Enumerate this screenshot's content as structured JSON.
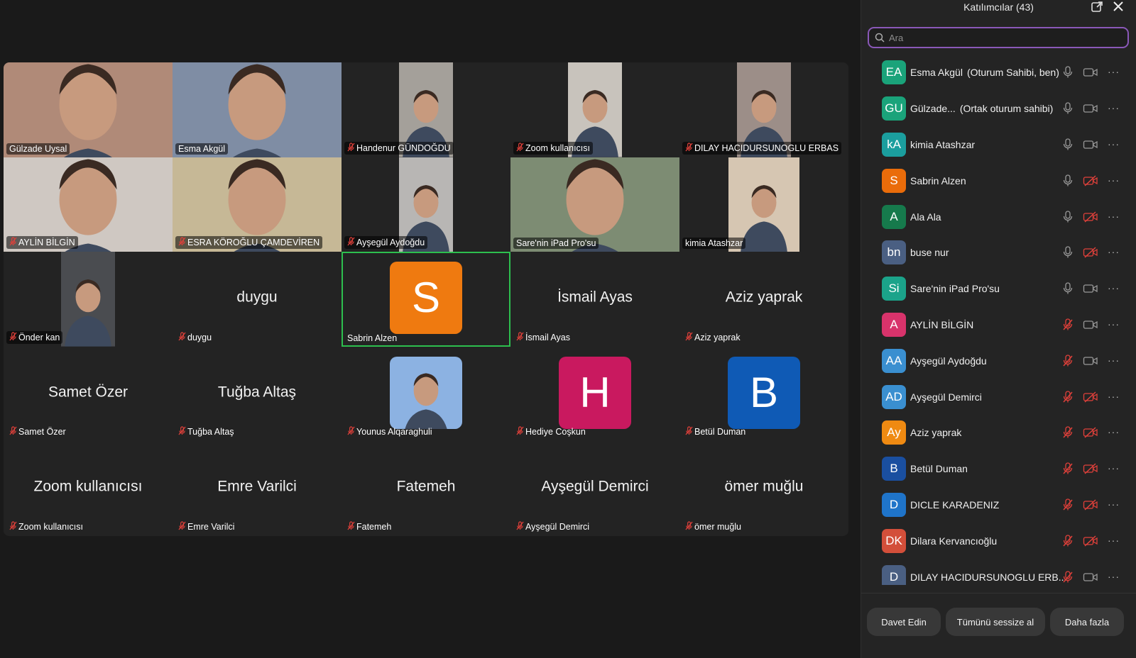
{
  "sidebar": {
    "title": "Katılımcılar (43)",
    "search_placeholder": "Ara",
    "participants": [
      {
        "initials": "EA",
        "name": "Esma Akgül",
        "role": "(Oturum Sahibi, ben)",
        "color": "#1aa37a",
        "mic": "on",
        "cam": "on"
      },
      {
        "initials": "GU",
        "name": "Gülzade...",
        "role": "(Ortak oturum sahibi)",
        "color": "#1aa37a",
        "mic": "on",
        "cam": "on"
      },
      {
        "initials": "kA",
        "name": "kimia Atashzar",
        "role": "",
        "color": "#1b9e9e",
        "mic": "on",
        "cam": "on"
      },
      {
        "initials": "S",
        "name": "Sabrin Alzen",
        "role": "",
        "color": "#ea6c0a",
        "mic": "on",
        "cam": "off"
      },
      {
        "initials": "A",
        "name": "Ala Ala",
        "role": "",
        "color": "#167a4c",
        "mic": "on",
        "cam": "off"
      },
      {
        "initials": "bn",
        "name": "buse nur",
        "role": "",
        "color": "#4a5f82",
        "mic": "on",
        "cam": "off"
      },
      {
        "initials": "Si",
        "name": "Sare'nin iPad Pro'su",
        "role": "",
        "color": "#1ba38a",
        "mic": "on",
        "cam": "on"
      },
      {
        "initials": "A",
        "name": "AYLİN BİLGİN",
        "role": "",
        "color": "#d8336b",
        "mic": "off",
        "cam": "on"
      },
      {
        "initials": "AA",
        "name": "Ayşegül Aydoğdu",
        "role": "",
        "color": "#3a8fd0",
        "mic": "off",
        "cam": "on"
      },
      {
        "initials": "AD",
        "name": "Ayşegül Demirci",
        "role": "",
        "color": "#3a8fd0",
        "mic": "off",
        "cam": "off"
      },
      {
        "initials": "Ay",
        "name": "Aziz yaprak",
        "role": "",
        "color": "#ef8a12",
        "mic": "off",
        "cam": "off"
      },
      {
        "initials": "B",
        "name": "Betül Duman",
        "role": "",
        "color": "#1a4fa0",
        "mic": "off",
        "cam": "off"
      },
      {
        "initials": "D",
        "name": "DICLE KARADENIZ",
        "role": "",
        "color": "#1f74c9",
        "mic": "off",
        "cam": "off"
      },
      {
        "initials": "DK",
        "name": "Dilara Kervancıoğlu",
        "role": "",
        "color": "#d34f3a",
        "mic": "off",
        "cam": "off"
      },
      {
        "initials": "D",
        "name": "DILAY HACIDURSUNOGLU ERB...",
        "role": "",
        "color": "#4a5f82",
        "mic": "off",
        "cam": "on"
      }
    ],
    "buttons": {
      "invite": "Davet Edin",
      "mute_all": "Tümünü sessize al",
      "more": "Daha fazla"
    }
  },
  "gallery": {
    "tiles": [
      {
        "name": "Gülzade Uysal",
        "muted": false,
        "type": "video",
        "video": "full",
        "bg": "#b08a78",
        "center": ""
      },
      {
        "name": "Esma Akgül",
        "muted": false,
        "type": "video",
        "video": "full",
        "bg": "#7f8da4",
        "center": ""
      },
      {
        "name": "Handenur GÜNDOĞDU",
        "muted": true,
        "type": "video",
        "video": "narrow",
        "bg": "#a4a09a",
        "center": ""
      },
      {
        "name": "Zoom kullanıcısı",
        "muted": true,
        "type": "video",
        "video": "narrow",
        "bg": "#c8c3bc",
        "center": ""
      },
      {
        "name": "DILAY HACIDURSUNOGLU ERBAS",
        "muted": true,
        "type": "video",
        "video": "narrow",
        "bg": "#9c8e88",
        "center": ""
      },
      {
        "name": "AYLİN BİLGİN",
        "muted": true,
        "type": "video",
        "video": "full",
        "bg": "#cfc8c2",
        "center": ""
      },
      {
        "name": "ESRA KÖROĞLU ÇAMDEVİREN",
        "muted": true,
        "type": "video",
        "video": "full",
        "bg": "#c6b896",
        "center": ""
      },
      {
        "name": "Ayşegül Aydoğdu",
        "muted": true,
        "type": "video",
        "video": "narrow",
        "bg": "#b8b6b4",
        "center": ""
      },
      {
        "name": "Sare'nin iPad Pro'su",
        "muted": false,
        "type": "video",
        "video": "full",
        "bg": "#7d8c73",
        "center": ""
      },
      {
        "name": "kimia Atashzar",
        "muted": false,
        "type": "video",
        "video": "mid",
        "bg": "#d6c6b2",
        "center": ""
      },
      {
        "name": "Önder kan",
        "muted": true,
        "type": "video",
        "video": "narrow",
        "bg": "#4a4c50",
        "center": ""
      },
      {
        "name": "duygu",
        "muted": true,
        "type": "text",
        "center": "duygu"
      },
      {
        "name": "Sabrin Alzen",
        "muted": false,
        "type": "avatar",
        "letter": "S",
        "avatar_color": "#ef7a10",
        "active": true
      },
      {
        "name": "İsmail Ayas",
        "muted": true,
        "type": "text",
        "center": "İsmail Ayas"
      },
      {
        "name": "Aziz yaprak",
        "muted": true,
        "type": "text",
        "center": "Aziz yaprak"
      },
      {
        "name": "Samet Özer",
        "muted": true,
        "type": "text",
        "center": "Samet Özer"
      },
      {
        "name": "Tuğba Altaş",
        "muted": true,
        "type": "text",
        "center": "Tuğba Altaş"
      },
      {
        "name": "Younus Alqaraghuli",
        "muted": true,
        "type": "photo",
        "photo_bg": "#8cb2e2"
      },
      {
        "name": "Hediye Coşkun",
        "muted": true,
        "type": "avatar",
        "letter": "H",
        "avatar_color": "#c9195f"
      },
      {
        "name": "Betül Duman",
        "muted": true,
        "type": "avatar",
        "letter": "B",
        "avatar_color": "#0f5ab5"
      },
      {
        "name": "Zoom kullanıcısı",
        "muted": true,
        "type": "text",
        "center": "Zoom kullanıcısı"
      },
      {
        "name": "Emre Varilci",
        "muted": true,
        "type": "text",
        "center": "Emre Varilci"
      },
      {
        "name": "Fatemeh",
        "muted": true,
        "type": "text",
        "center": "Fatemeh"
      },
      {
        "name": "Ayşegül Demirci",
        "muted": true,
        "type": "text",
        "center": "Ayşegül Demirci"
      },
      {
        "name": "ömer muğlu",
        "muted": true,
        "type": "text",
        "center": "ömer muğlu"
      }
    ]
  }
}
